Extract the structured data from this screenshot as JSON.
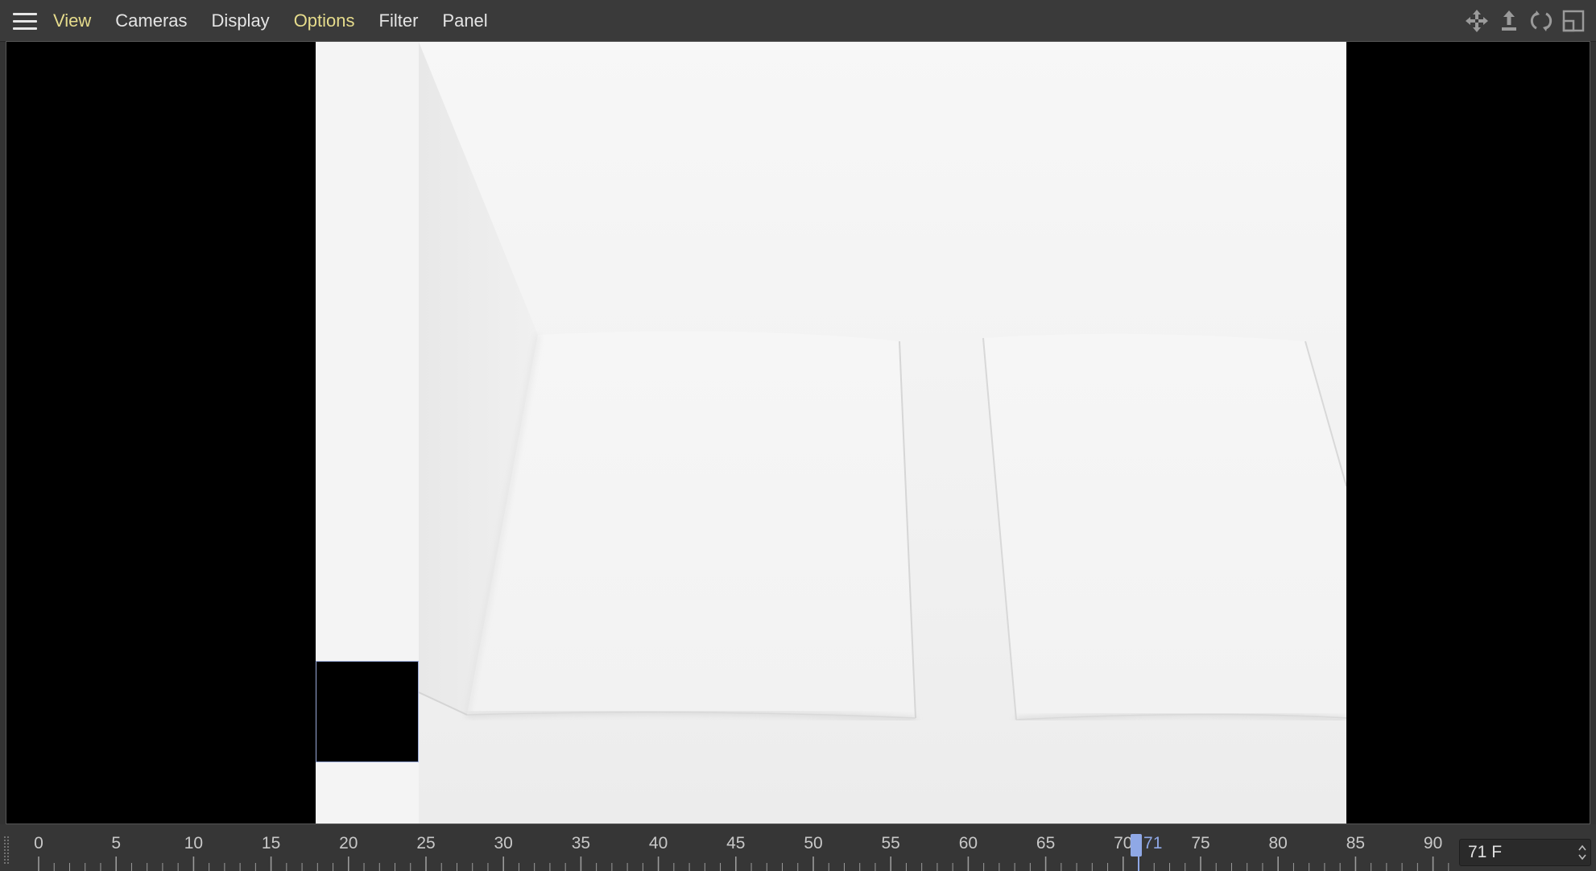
{
  "menubar": {
    "menu_icon": "hamburger-menu-icon",
    "items": [
      {
        "label": "View",
        "highlighted": true
      },
      {
        "label": "Cameras",
        "highlighted": false
      },
      {
        "label": "Display",
        "highlighted": false
      },
      {
        "label": "Options",
        "highlighted": true
      },
      {
        "label": "Filter",
        "highlighted": false
      },
      {
        "label": "Panel",
        "highlighted": false
      }
    ],
    "tools": [
      {
        "icon": "move-pan-icon"
      },
      {
        "icon": "dolly-icon"
      },
      {
        "icon": "rotate-orbit-icon"
      },
      {
        "icon": "maximize-panel-icon"
      }
    ],
    "highlight_color": "#e6dc8c"
  },
  "viewport": {
    "background_color": "#000000",
    "render_background_color": "#f4f4f4"
  },
  "timeline": {
    "ticks": [
      "0",
      "5",
      "10",
      "15",
      "20",
      "25",
      "30",
      "35",
      "40",
      "45",
      "50",
      "55",
      "60",
      "65",
      "70",
      "75",
      "80",
      "85",
      "90"
    ],
    "current_frame": "71",
    "frame_field_value": "71 F",
    "accent_color": "#8fa8e6"
  }
}
